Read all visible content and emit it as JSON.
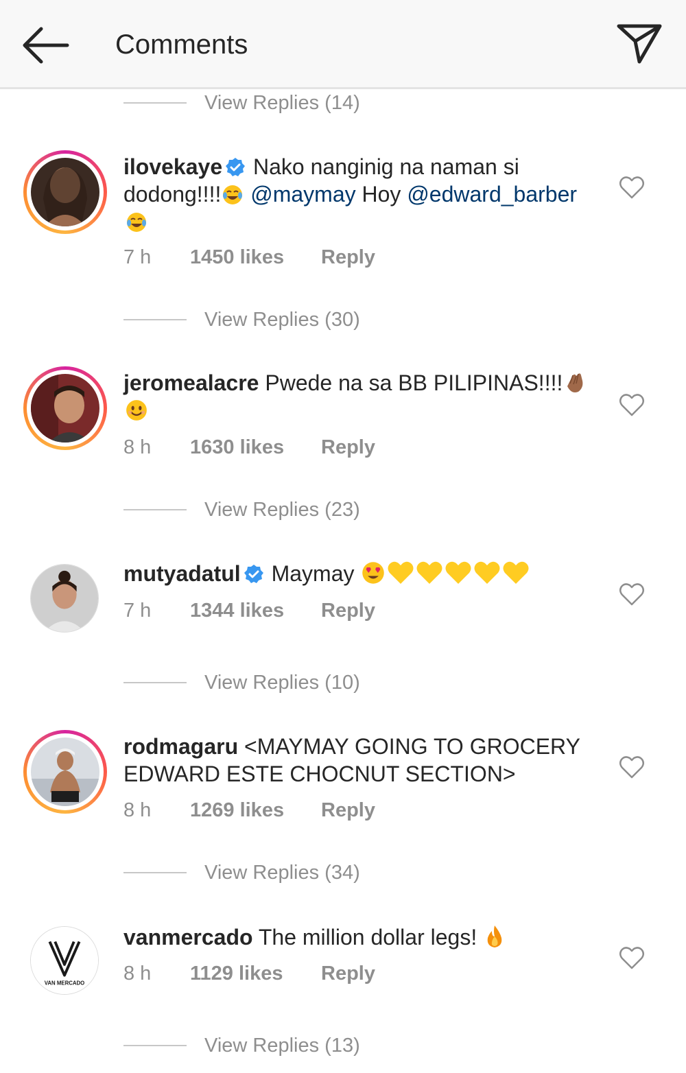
{
  "header": {
    "title": "Comments"
  },
  "view_replies_top": "View Replies (14)",
  "comments": [
    {
      "username": "ilovekaye",
      "verified": true,
      "text_1": "Nako nanginig na naman si",
      "text_2": "dodong!!!!",
      "mention_1": "@maymay",
      "text_3": "Hoy",
      "mention_2": "@edward_barber",
      "time": "7 h",
      "likes": "1450 likes",
      "reply_label": "Reply",
      "view_replies": "View Replies (30)"
    },
    {
      "username": "jeromealacre",
      "verified": false,
      "text_1": "Pwede na sa BB PILIPINAS!!!!",
      "time": "8 h",
      "likes": "1630 likes",
      "reply_label": "Reply",
      "view_replies": "View Replies (23)"
    },
    {
      "username": "mutyadatul",
      "verified": true,
      "text_1": "Maymay",
      "time": "7 h",
      "likes": "1344 likes",
      "reply_label": "Reply",
      "view_replies": "View Replies (10)"
    },
    {
      "username": "rodmagaru",
      "verified": false,
      "text_1": "<MAYMAY GOING TO GROCERY",
      "text_2": "EDWARD ESTE CHOCNUT SECTION>",
      "time": "8 h",
      "likes": "1269 likes",
      "reply_label": "Reply",
      "view_replies": "View Replies (34)"
    },
    {
      "username": "vanmercado",
      "verified": false,
      "text_1": "The million dollar legs!",
      "avatar_logo_text": "VAN MERCADO",
      "time": "8 h",
      "likes": "1129 likes",
      "reply_label": "Reply",
      "view_replies": "View Replies (13)"
    }
  ],
  "icons": {
    "back": "arrow-left-icon",
    "send": "paper-plane-icon",
    "verified": "verified-badge-icon",
    "like": "heart-outline-icon",
    "emojis": [
      "tears-of-joy",
      "smiling-face",
      "clapping-hands",
      "heart-eyes",
      "yellow-heart",
      "fire"
    ]
  },
  "colors": {
    "header_bg": "#f8f8f8",
    "text": "#262626",
    "secondary_text": "#8e8e8e",
    "mention": "#00376b",
    "verified_blue": "#3897f0",
    "yellow_heart": "#ffcc22"
  }
}
